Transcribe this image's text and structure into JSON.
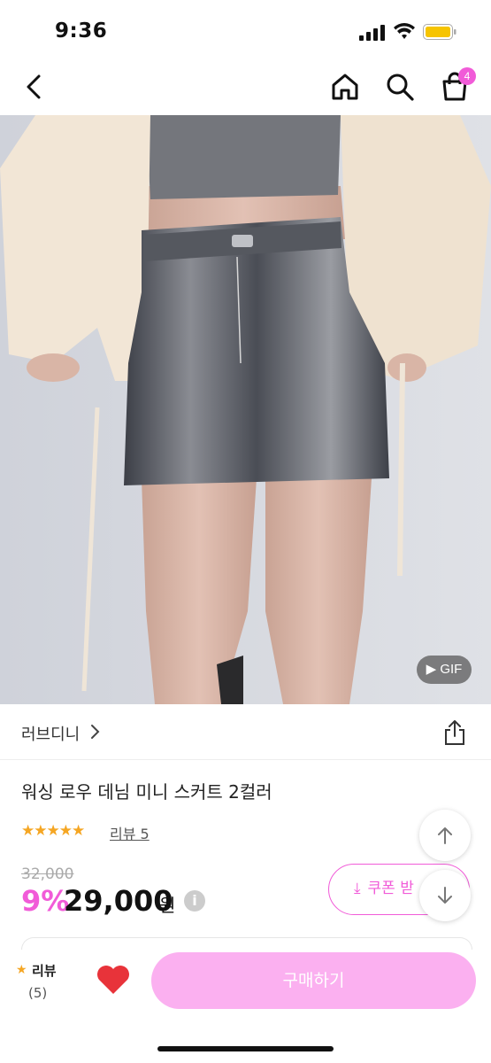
{
  "status_bar": {
    "time": "9:36"
  },
  "nav": {
    "cart_count": "4"
  },
  "media": {
    "gif_label": "▶ GIF"
  },
  "store": {
    "name": "러브디니"
  },
  "product": {
    "title": "워싱 로우 데님 미니 스커트 2컬러",
    "rating_stars": "★★★★★",
    "review_link": "리뷰 5",
    "original_price": "32,000",
    "discount": "9%",
    "price": "29,000",
    "currency": "원",
    "coupon_label": "쿠폰 받"
  },
  "bottom_bar": {
    "review_label": "리뷰",
    "review_count": "(5)",
    "buy_label": "구매하기"
  },
  "colors": {
    "accent": "#f15bd8",
    "buy_button": "#fbb0f0",
    "star": "#f5a623",
    "heart": "#e8333a"
  }
}
